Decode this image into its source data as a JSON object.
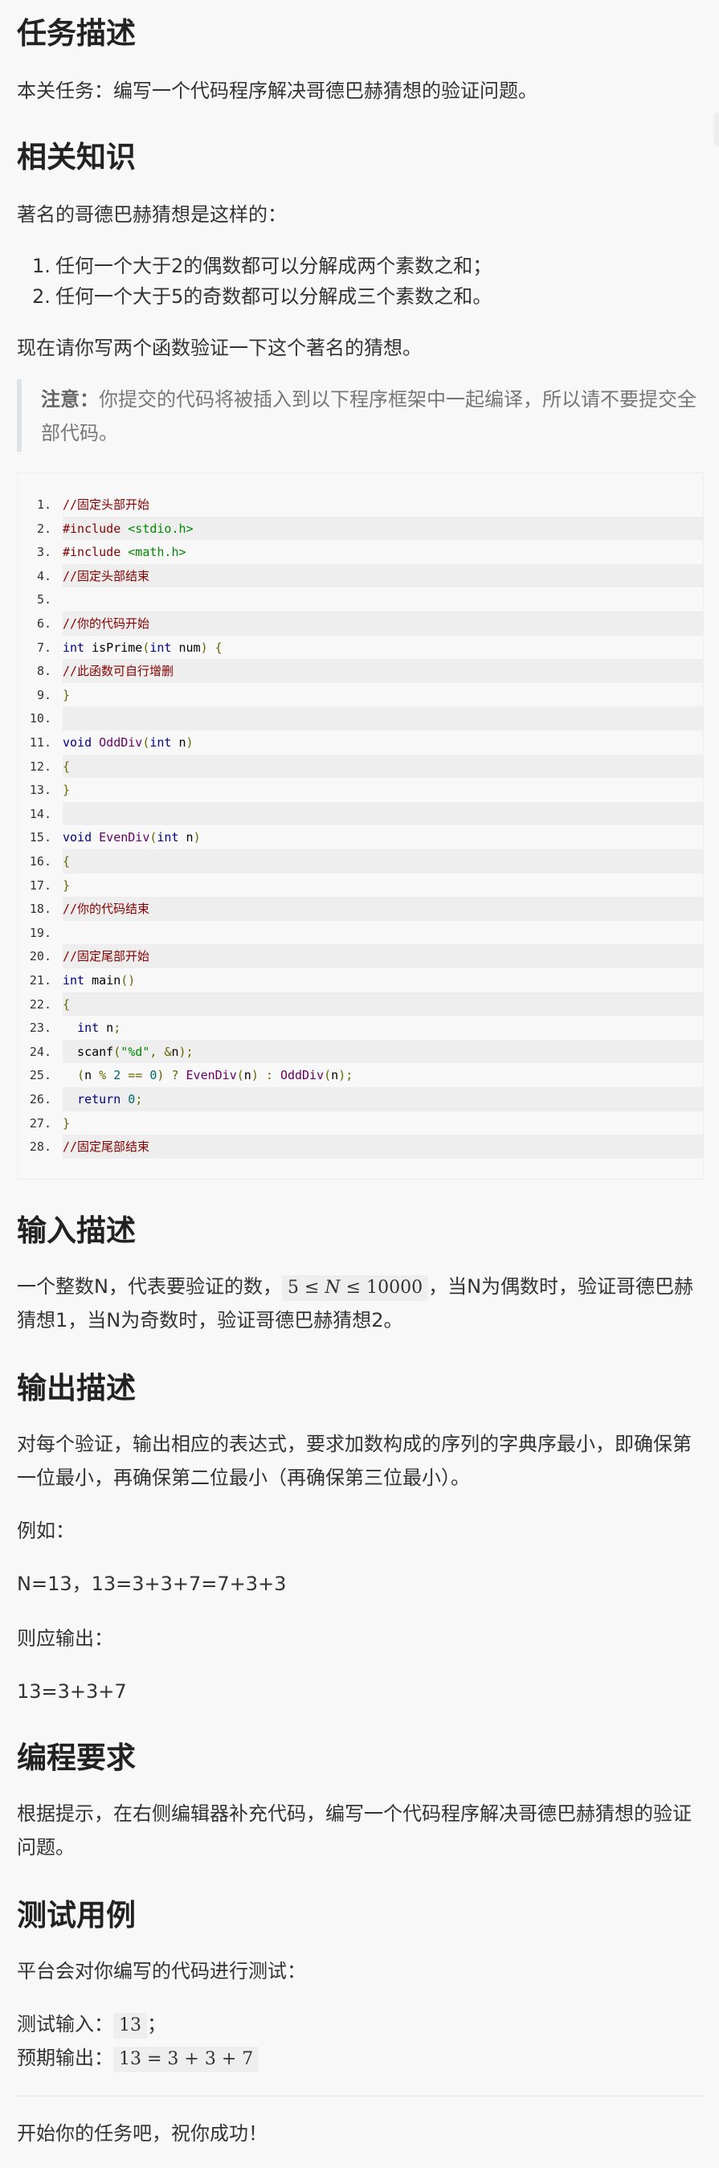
{
  "sections": {
    "task": {
      "heading": "任务描述",
      "text": "本关任务：编写一个代码程序解决哥德巴赫猜想的验证问题。"
    },
    "knowledge": {
      "heading": "相关知识",
      "intro": "著名的哥德巴赫猜想是这样的：",
      "items": [
        {
          "num": "1.",
          "text": "任何一个大于2的偶数都可以分解成两个素数之和；"
        },
        {
          "num": "2.",
          "text": "任何一个大于5的奇数都可以分解成三个素数之和。"
        }
      ],
      "after": "现在请你写两个函数验证一下这个著名的猜想。",
      "note_label": "注意：",
      "note_text": "你提交的代码将被插入到以下程序框架中一起编译，所以请不要提交全部代码。"
    },
    "input": {
      "heading": "输入描述",
      "text_before": "一个整数N，代表要验证的数，",
      "text_after": "，当N为偶数时，验证哥德巴赫猜想1，当N为奇数时，验证哥德巴赫猜想2。",
      "math": {
        "lo": "5",
        "le": "≤",
        "var": "N",
        "hi": "10000"
      }
    },
    "output": {
      "heading": "输出描述",
      "text": "对每个验证，输出相应的表达式，要求加数构成的序列的字典序最小，即确保第一位最小，再确保第二位最小（再确保第三位最小）。",
      "example_label": "例如：",
      "example": "N=13，13=3+3+7=7+3+3",
      "should_label": "则应输出：",
      "should": "13=3+3+7"
    },
    "requirement": {
      "heading": "编程要求",
      "text": "根据提示，在右侧编辑器补充代码，编写一个代码程序解决哥德巴赫猜想的验证问题。"
    },
    "tests": {
      "heading": "测试用例",
      "intro": "平台会对你编写的代码进行测试：",
      "input_label": "测试输入：",
      "input_value": "13",
      "input_suffix": "；",
      "output_label": "预期输出：",
      "output_value": "13 = 3 + 3 + 7"
    },
    "closing": "开始你的任务吧，祝你成功！"
  },
  "code_lines": [
    [
      [
        "c-com",
        "//固定头部开始"
      ]
    ],
    [
      [
        "c-com",
        "#include "
      ],
      [
        "c-str",
        "<stdio.h>"
      ]
    ],
    [
      [
        "c-com",
        "#include "
      ],
      [
        "c-str",
        "<math.h>"
      ]
    ],
    [
      [
        "c-com",
        "//固定头部结束"
      ]
    ],
    [],
    [
      [
        "c-com",
        "//你的代码开始"
      ]
    ],
    [
      [
        "c-kw",
        "int"
      ],
      [
        "c-pln",
        " isPrime"
      ],
      [
        "c-pun",
        "("
      ],
      [
        "c-kw",
        "int"
      ],
      [
        "c-pln",
        " num"
      ],
      [
        "c-pun",
        ")"
      ],
      [
        "c-pln",
        " "
      ],
      [
        "c-pun",
        "{"
      ]
    ],
    [
      [
        "c-com",
        "//此函数可自行增删"
      ]
    ],
    [
      [
        "c-pun",
        "}"
      ]
    ],
    [],
    [
      [
        "c-kw",
        "void"
      ],
      [
        "c-pln",
        " "
      ],
      [
        "c-fn",
        "OddDiv"
      ],
      [
        "c-pun",
        "("
      ],
      [
        "c-kw",
        "int"
      ],
      [
        "c-pln",
        " n"
      ],
      [
        "c-pun",
        ")"
      ]
    ],
    [
      [
        "c-pun",
        "{"
      ]
    ],
    [
      [
        "c-pun",
        "}"
      ]
    ],
    [],
    [
      [
        "c-kw",
        "void"
      ],
      [
        "c-pln",
        " "
      ],
      [
        "c-fn",
        "EvenDiv"
      ],
      [
        "c-pun",
        "("
      ],
      [
        "c-kw",
        "int"
      ],
      [
        "c-pln",
        " n"
      ],
      [
        "c-pun",
        ")"
      ]
    ],
    [
      [
        "c-pun",
        "{"
      ]
    ],
    [
      [
        "c-pun",
        "}"
      ]
    ],
    [
      [
        "c-com",
        "//你的代码结束"
      ]
    ],
    [],
    [
      [
        "c-com",
        "//固定尾部开始"
      ]
    ],
    [
      [
        "c-kw",
        "int"
      ],
      [
        "c-pln",
        " main"
      ],
      [
        "c-pun",
        "()"
      ]
    ],
    [
      [
        "c-pun",
        "{"
      ]
    ],
    [
      [
        "c-pln",
        "  "
      ],
      [
        "c-kw",
        "int"
      ],
      [
        "c-pln",
        " n"
      ],
      [
        "c-pun",
        ";"
      ]
    ],
    [
      [
        "c-pln",
        "  scanf"
      ],
      [
        "c-pun",
        "("
      ],
      [
        "c-str",
        "\"%d\""
      ],
      [
        "c-pun",
        ","
      ],
      [
        "c-pln",
        " "
      ],
      [
        "c-pun",
        "&"
      ],
      [
        "c-pln",
        "n"
      ],
      [
        "c-pun",
        ");"
      ]
    ],
    [
      [
        "c-pln",
        "  "
      ],
      [
        "c-pun",
        "("
      ],
      [
        "c-pln",
        "n "
      ],
      [
        "c-pun",
        "%"
      ],
      [
        "c-pln",
        " "
      ],
      [
        "c-lit",
        "2"
      ],
      [
        "c-pln",
        " "
      ],
      [
        "c-pun",
        "=="
      ],
      [
        "c-pln",
        " "
      ],
      [
        "c-lit",
        "0"
      ],
      [
        "c-pun",
        ")"
      ],
      [
        "c-pln",
        " "
      ],
      [
        "c-pun",
        "?"
      ],
      [
        "c-pln",
        " "
      ],
      [
        "c-fn",
        "EvenDiv"
      ],
      [
        "c-pun",
        "("
      ],
      [
        "c-pln",
        "n"
      ],
      [
        "c-pun",
        ")"
      ],
      [
        "c-pln",
        " "
      ],
      [
        "c-pun",
        ":"
      ],
      [
        "c-pln",
        " "
      ],
      [
        "c-fn",
        "OddDiv"
      ],
      [
        "c-pun",
        "("
      ],
      [
        "c-pln",
        "n"
      ],
      [
        "c-pun",
        ");"
      ]
    ],
    [
      [
        "c-pln",
        "  "
      ],
      [
        "c-kw",
        "return"
      ],
      [
        "c-pln",
        " "
      ],
      [
        "c-lit",
        "0"
      ],
      [
        "c-pun",
        ";"
      ]
    ],
    [
      [
        "c-pun",
        "}"
      ]
    ],
    [
      [
        "c-com",
        "//固定尾部结束"
      ]
    ]
  ]
}
